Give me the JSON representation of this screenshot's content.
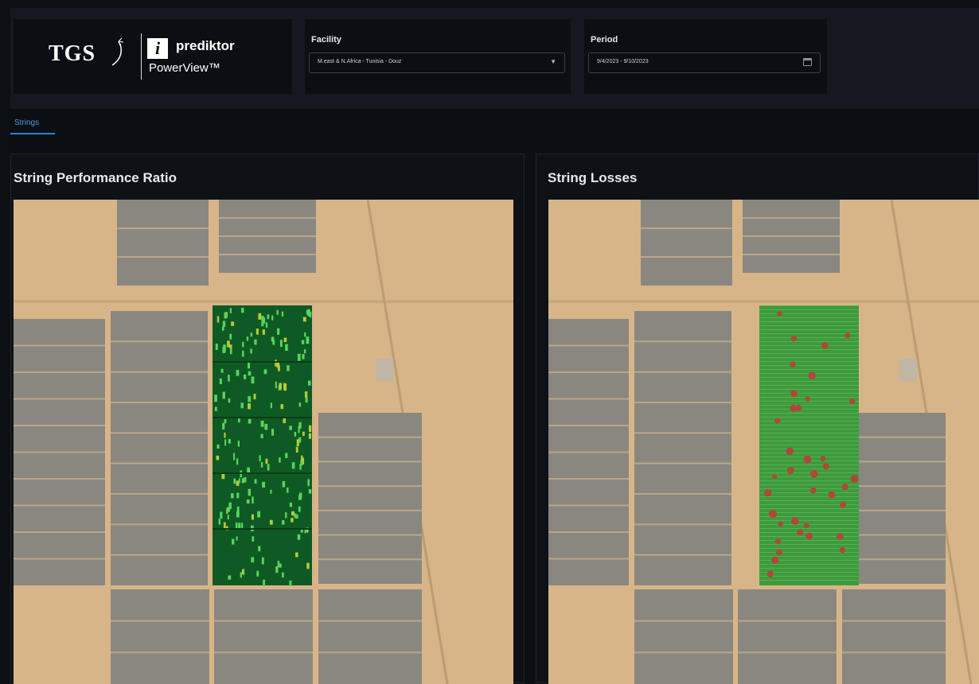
{
  "brand": {
    "tgs_logo": "TGS",
    "prediktor_icon": "i",
    "prediktor_name": "prediktor",
    "product_name": "PowerView™"
  },
  "filters": {
    "facility": {
      "label": "Facility",
      "value": "M.east & N.Africa - Tunisia - Douz"
    },
    "period": {
      "label": "Period",
      "value": "9/4/2023 - 9/10/2023"
    }
  },
  "tabs": [
    {
      "label": "Strings",
      "active": true
    }
  ],
  "panels": {
    "performance_ratio": {
      "title": "String Performance Ratio"
    },
    "losses": {
      "title": "String Losses"
    }
  },
  "colors": {
    "accent": "#2f7fd0",
    "sand": "#d8b588",
    "pv_array": "#8a8780",
    "pr_block_base": "#0f5a24",
    "pr_string_high": "#58d45c",
    "pr_string_mid": "#b8c93a",
    "loss_block_base": "#3e9b3c",
    "loss_marker": "#b2463a"
  },
  "icons": {
    "facility_dropdown": "chevron-down-icon",
    "period_picker": "calendar-icon"
  }
}
